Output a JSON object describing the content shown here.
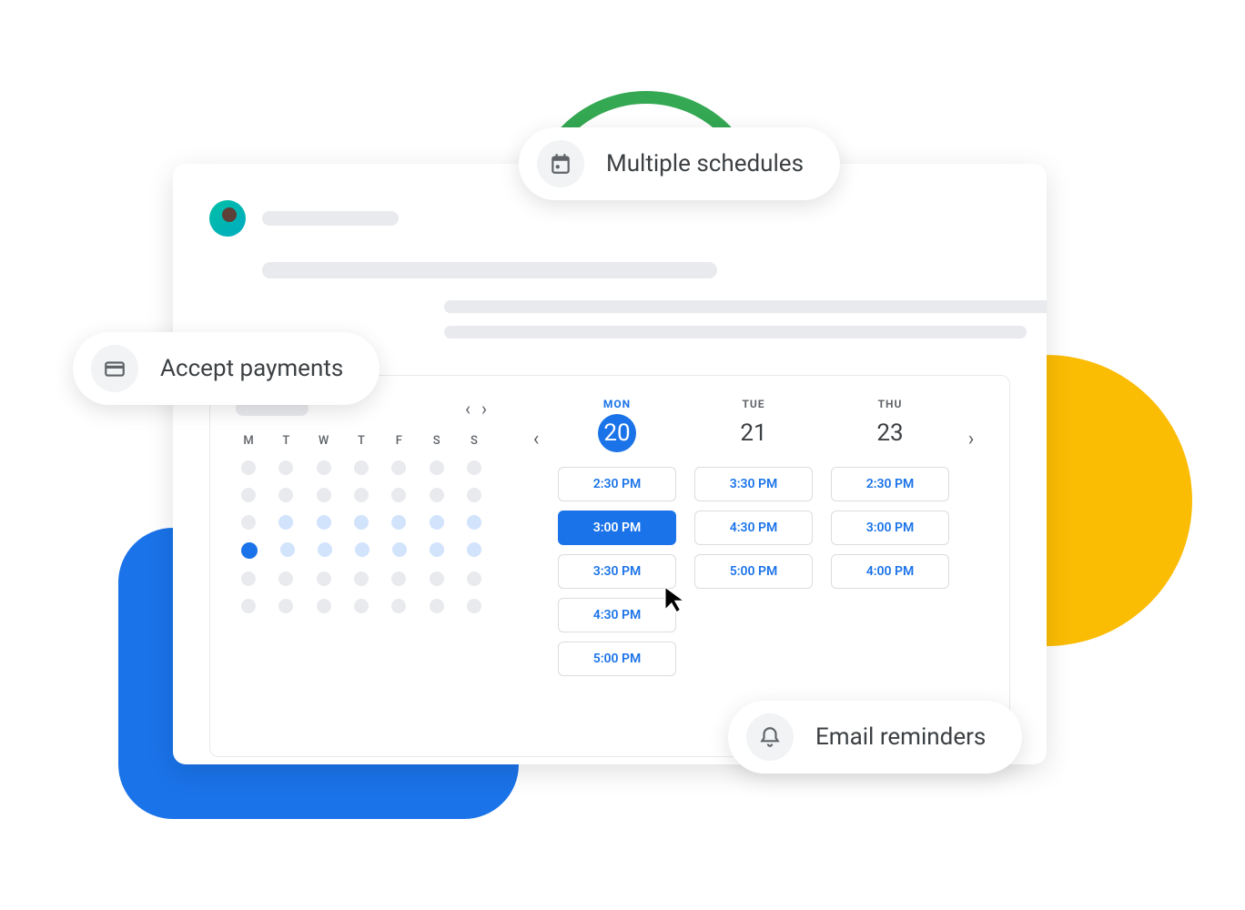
{
  "pills": {
    "schedules": "Multiple schedules",
    "payments": "Accept payments",
    "reminders": "Email reminders"
  },
  "mini_calendar": {
    "dow": [
      "M",
      "T",
      "W",
      "T",
      "F",
      "S",
      "S"
    ]
  },
  "days": [
    {
      "label": "MON",
      "num": "20",
      "active": true,
      "slots": [
        "2:30 PM",
        "3:00 PM",
        "3:30 PM",
        "4:30 PM",
        "5:00 PM"
      ],
      "selected_index": 1
    },
    {
      "label": "TUE",
      "num": "21",
      "active": false,
      "slots": [
        "3:30 PM",
        "4:30 PM",
        "5:00 PM"
      ]
    },
    {
      "label": "THU",
      "num": "23",
      "active": false,
      "slots": [
        "2:30 PM",
        "3:00 PM",
        "4:00 PM"
      ]
    }
  ],
  "colors": {
    "blue": "#1a73e8",
    "green": "#34a853",
    "yellow": "#fbbc04",
    "grey": "#5f6368"
  }
}
